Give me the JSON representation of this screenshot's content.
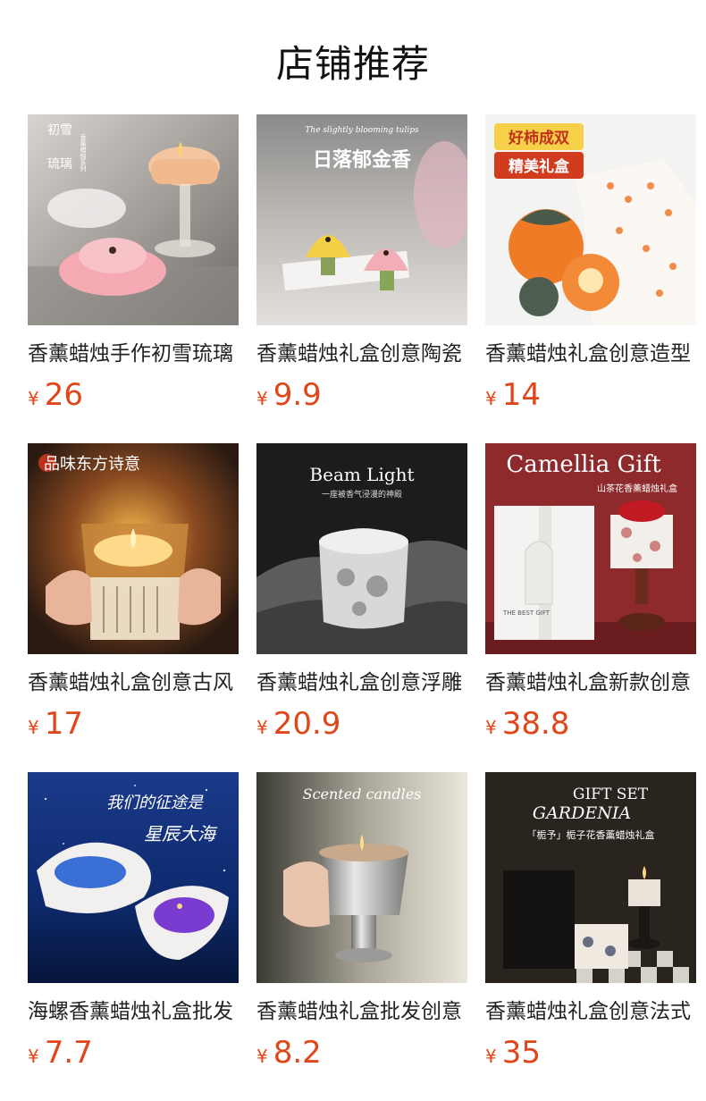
{
  "section_title": "店铺推荐",
  "currency_symbol": "¥",
  "accent_color": "#e0461a",
  "products": [
    {
      "name": "香薰蜡烛手作初雪琉璃",
      "price": "26",
      "image_text": [
        "初雪",
        "琉璃",
        "香薰蜡烛系列"
      ]
    },
    {
      "name": "香薰蜡烛礼盒创意陶瓷",
      "price": "9.9",
      "image_text": [
        "The slightly blooming tulips",
        "日落郁金香"
      ]
    },
    {
      "name": "香薰蜡烛礼盒创意造型",
      "price": "14",
      "image_text": [
        "好柿成双",
        "精美礼盒"
      ]
    },
    {
      "name": "香薰蜡烛礼盒创意古风",
      "price": "17",
      "image_text": [
        "品味东方诗意"
      ]
    },
    {
      "name": "香薰蜡烛礼盒创意浮雕",
      "price": "20.9",
      "image_text": [
        "Beam Light",
        "一座被香气浸漫的神殿"
      ]
    },
    {
      "name": "香薰蜡烛礼盒新款创意",
      "price": "38.8",
      "image_text": [
        "Camellia Gift",
        "山茶花香薰蜡烛礼盒",
        "THE BEST GIFT"
      ]
    },
    {
      "name": "海螺香薰蜡烛礼盒批发",
      "price": "7.7",
      "image_text": [
        "我们的征途是",
        "星辰大海"
      ]
    },
    {
      "name": "香薰蜡烛礼盒批发创意",
      "price": "8.2",
      "image_text": [
        "Scented candles"
      ]
    },
    {
      "name": "香薰蜡烛礼盒创意法式",
      "price": "35",
      "image_text": [
        "GIFT SET",
        "GARDENIA",
        "「栀予」栀子花香薰蜡烛礼盒"
      ]
    }
  ]
}
